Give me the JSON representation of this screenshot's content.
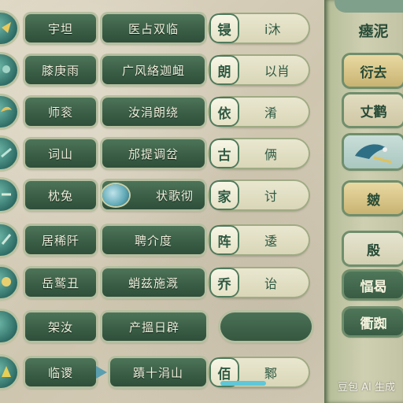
{
  "rows": [
    {
      "c1": "宇坦",
      "c2": "医占双临",
      "pill_char": "锓",
      "pill_text": "i沐"
    },
    {
      "c1": "膝庚雨",
      "c2": "广风絡迦衄",
      "pill_char": "朗",
      "pill_text": "以肖"
    },
    {
      "c1": "师衮",
      "c2": "汝涓朗绕",
      "pill_char": "依",
      "pill_text": "淆"
    },
    {
      "c1": "词山",
      "c2": "邡提调岔",
      "pill_char": "古",
      "pill_text": "俩"
    },
    {
      "c1": "枕兔",
      "c2": "状歌彻",
      "pill_char": "家",
      "pill_text": "讨"
    },
    {
      "c1": "居稀阡",
      "c2": "聘介度",
      "pill_char": "阵",
      "pill_text": "逶"
    },
    {
      "c1": "岳鹫丑",
      "c2": "蛸兹施溉",
      "pill_char": "乔",
      "pill_text": "诒"
    },
    {
      "c1": "架汝",
      "c2": "产搵日辟",
      "pill_char": "",
      "pill_text": ""
    },
    {
      "c1": "临谡",
      "c2": "蹟十涓山",
      "pill_char": "佰",
      "pill_text": "鄹"
    }
  ],
  "side_panel": {
    "title": "瘗泥",
    "tiles": [
      "衍去",
      "丈鹳",
      "",
      "皴",
      "殷",
      "愊曷",
      "衢踟"
    ]
  },
  "watermark": "豆包 AI 生成",
  "colors": {
    "button": "#3f6449",
    "pill": "#e4e1c6",
    "accent": "#5fc7d8"
  }
}
